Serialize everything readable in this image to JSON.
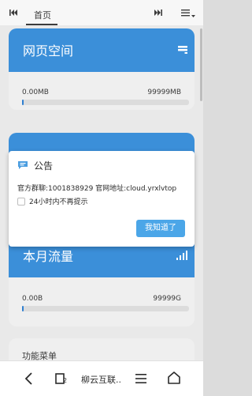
{
  "browser": {
    "tab_label": "首页",
    "page_title": "柳云互联..",
    "tab_count": "2"
  },
  "cards": {
    "webspace": {
      "title": "网页空间",
      "used": "0.00MB",
      "total": "99999MB",
      "progress": 0.0
    },
    "traffic": {
      "title": "本月流量",
      "used": "0.00B",
      "total": "99999G",
      "progress": 0.0
    },
    "menu": {
      "title": "功能菜单"
    }
  },
  "dialog": {
    "title": "公告",
    "body": "官方群聊:1001838929 官网地址:cloud.yrxlvtop",
    "checkbox_label": "24小时内不再提示",
    "checkbox_checked": false,
    "ok_label": "我知道了"
  },
  "icons": {
    "prev": "skip-previous-icon",
    "next": "skip-next-icon",
    "menu": "menu-dropdown-icon",
    "server": "server-icon",
    "bars": "signal-bars-icon",
    "notice": "chat-bubble-icon",
    "back": "back-arrow-icon",
    "tabs": "tabs-icon",
    "more": "hamburger-menu-icon",
    "home": "home-icon"
  },
  "colors": {
    "accent": "#3b8fd9",
    "button": "#4ba6e8"
  }
}
